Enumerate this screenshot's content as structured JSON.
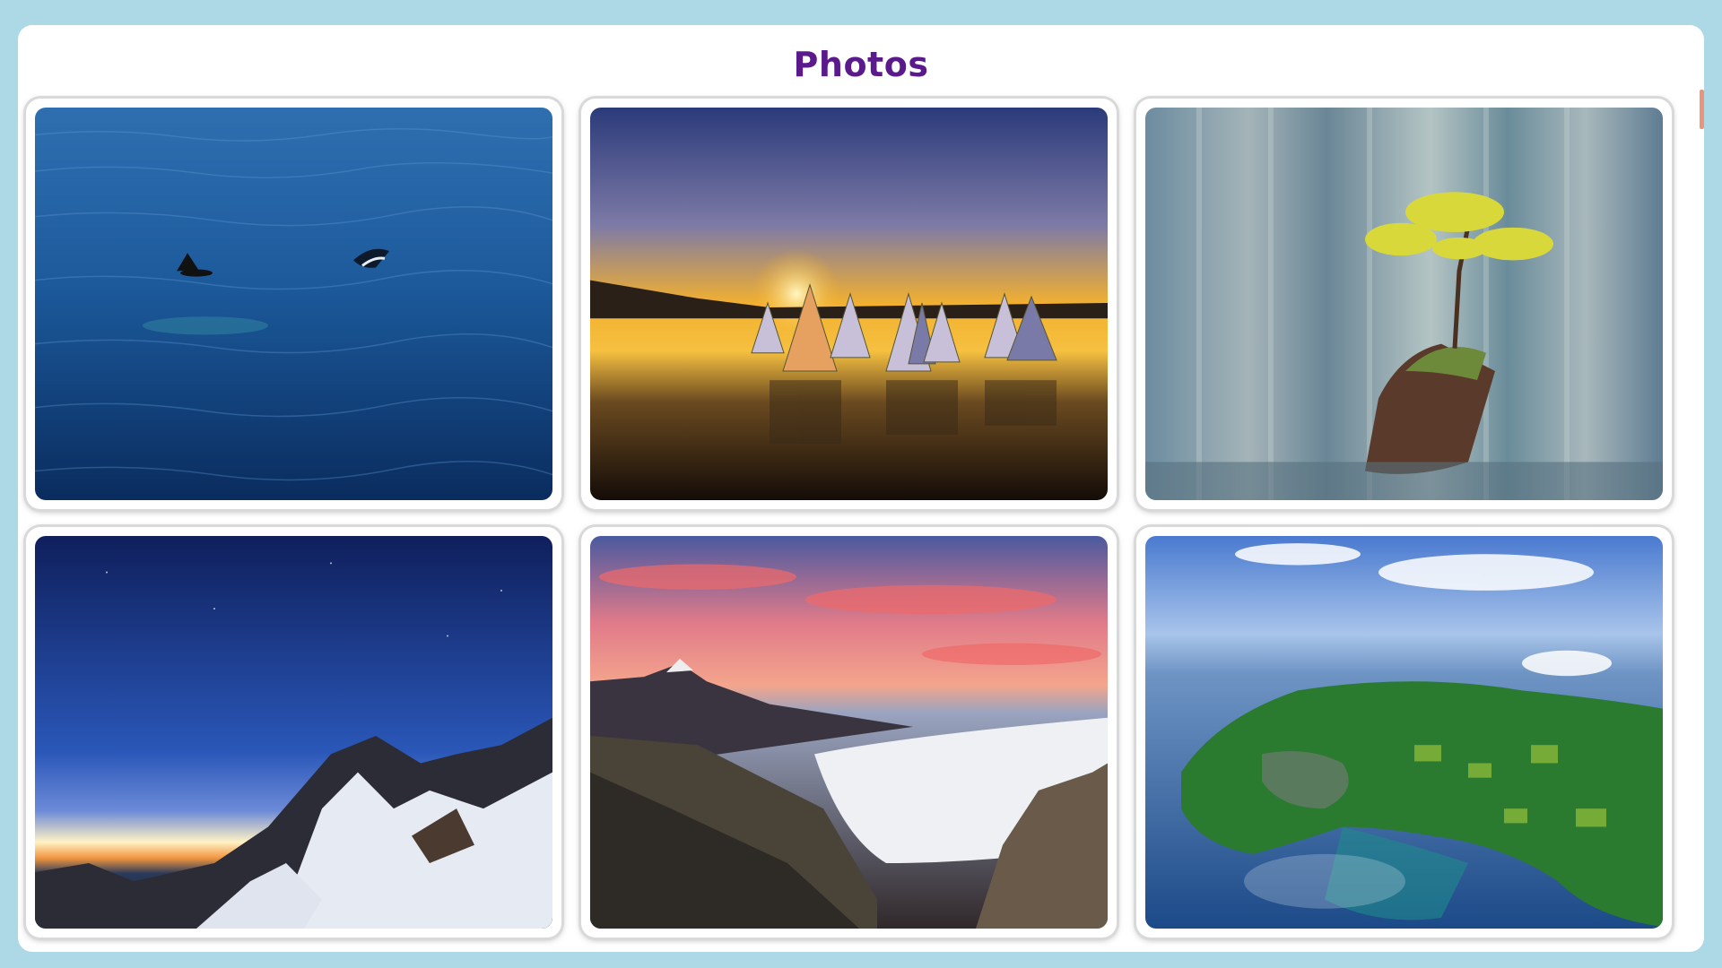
{
  "header": {
    "title": "Photos"
  },
  "photos": [
    {
      "name": "photo-orcas-ocean"
    },
    {
      "name": "photo-sunset-sails"
    },
    {
      "name": "photo-bonsai-tree-lake"
    },
    {
      "name": "photo-snowy-mountain-night"
    },
    {
      "name": "photo-volcano-cloud-sea"
    },
    {
      "name": "photo-aerial-island"
    }
  ],
  "colors": {
    "page_background": "#add8e6",
    "panel_background": "#ffffff",
    "title_color": "#5a1a8c",
    "scroll_indicator": "#e8957a"
  }
}
